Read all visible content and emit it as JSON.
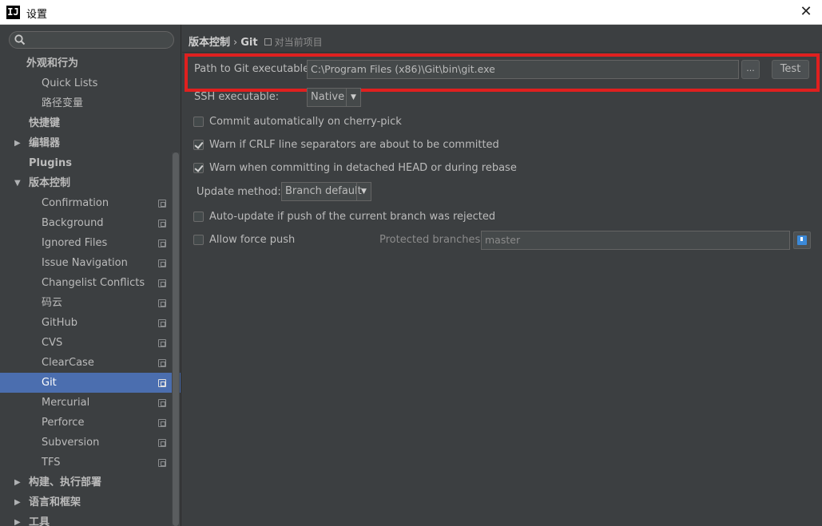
{
  "window": {
    "app_icon": "IJ",
    "title": "设置",
    "close_glyph": "✕"
  },
  "sidebar": {
    "search_placeholder": "",
    "items": [
      {
        "label": "外观和行为",
        "indent": 1,
        "bold": true,
        "expanded": null,
        "project": false
      },
      {
        "label": "Quick Lists",
        "indent": 2,
        "bold": false,
        "expanded": null,
        "project": false
      },
      {
        "label": "路径变量",
        "indent": 2,
        "bold": false,
        "expanded": null,
        "project": false
      },
      {
        "label": "快捷键",
        "indent": 1,
        "bold": true,
        "expanded": null,
        "project": false
      },
      {
        "label": "编辑器",
        "indent": 1,
        "bold": true,
        "expanded": false,
        "project": false
      },
      {
        "label": "Plugins",
        "indent": 1,
        "bold": true,
        "expanded": null,
        "project": false
      },
      {
        "label": "版本控制",
        "indent": 1,
        "bold": true,
        "expanded": true,
        "project": false
      },
      {
        "label": "Confirmation",
        "indent": 2,
        "bold": false,
        "expanded": null,
        "project": true
      },
      {
        "label": "Background",
        "indent": 2,
        "bold": false,
        "expanded": null,
        "project": true
      },
      {
        "label": "Ignored Files",
        "indent": 2,
        "bold": false,
        "expanded": null,
        "project": true
      },
      {
        "label": "Issue Navigation",
        "indent": 2,
        "bold": false,
        "expanded": null,
        "project": true
      },
      {
        "label": "Changelist Conflicts",
        "indent": 2,
        "bold": false,
        "expanded": null,
        "project": true
      },
      {
        "label": "码云",
        "indent": 2,
        "bold": false,
        "expanded": null,
        "project": true
      },
      {
        "label": "GitHub",
        "indent": 2,
        "bold": false,
        "expanded": null,
        "project": true
      },
      {
        "label": "CVS",
        "indent": 2,
        "bold": false,
        "expanded": null,
        "project": true
      },
      {
        "label": "ClearCase",
        "indent": 2,
        "bold": false,
        "expanded": null,
        "project": true
      },
      {
        "label": "Git",
        "indent": 2,
        "bold": false,
        "expanded": null,
        "project": true,
        "selected": true
      },
      {
        "label": "Mercurial",
        "indent": 2,
        "bold": false,
        "expanded": null,
        "project": true
      },
      {
        "label": "Perforce",
        "indent": 2,
        "bold": false,
        "expanded": null,
        "project": true
      },
      {
        "label": "Subversion",
        "indent": 2,
        "bold": false,
        "expanded": null,
        "project": true
      },
      {
        "label": "TFS",
        "indent": 2,
        "bold": false,
        "expanded": null,
        "project": true
      },
      {
        "label": "构建、执行部署",
        "indent": 1,
        "bold": true,
        "expanded": false,
        "project": false
      },
      {
        "label": "语言和框架",
        "indent": 1,
        "bold": true,
        "expanded": false,
        "project": false
      },
      {
        "label": "工具",
        "indent": 1,
        "bold": true,
        "expanded": false,
        "project": false
      }
    ]
  },
  "breadcrumb": {
    "parent": "版本控制",
    "separator": "›",
    "current": "Git",
    "scope_note": "对当前项目"
  },
  "git_settings": {
    "path_label": "Path to Git executable:",
    "path_value": "C:\\Program Files (x86)\\Git\\bin\\git.exe",
    "browse_label": "...",
    "test_label": "Test",
    "ssh_label": "SSH executable:",
    "ssh_value": "Native",
    "commit_cherry_pick": {
      "label": "Commit automatically on cherry-pick",
      "checked": false
    },
    "warn_crlf": {
      "label": "Warn if CRLF line separators are about to be committed",
      "checked": true
    },
    "warn_detached": {
      "label": "Warn when committing in detached HEAD or during rebase",
      "checked": true
    },
    "update_method_label": "Update method:",
    "update_method_value": "Branch default",
    "auto_update": {
      "label": "Auto-update if push of the current branch was rejected",
      "checked": false
    },
    "allow_force_push": {
      "label": "Allow force push",
      "checked": false
    },
    "protected_label": "Protected branches:",
    "protected_value": "master"
  },
  "colors": {
    "selection": "#4b6eaf",
    "highlight_box": "#e0201f",
    "background": "#3c3f41"
  }
}
